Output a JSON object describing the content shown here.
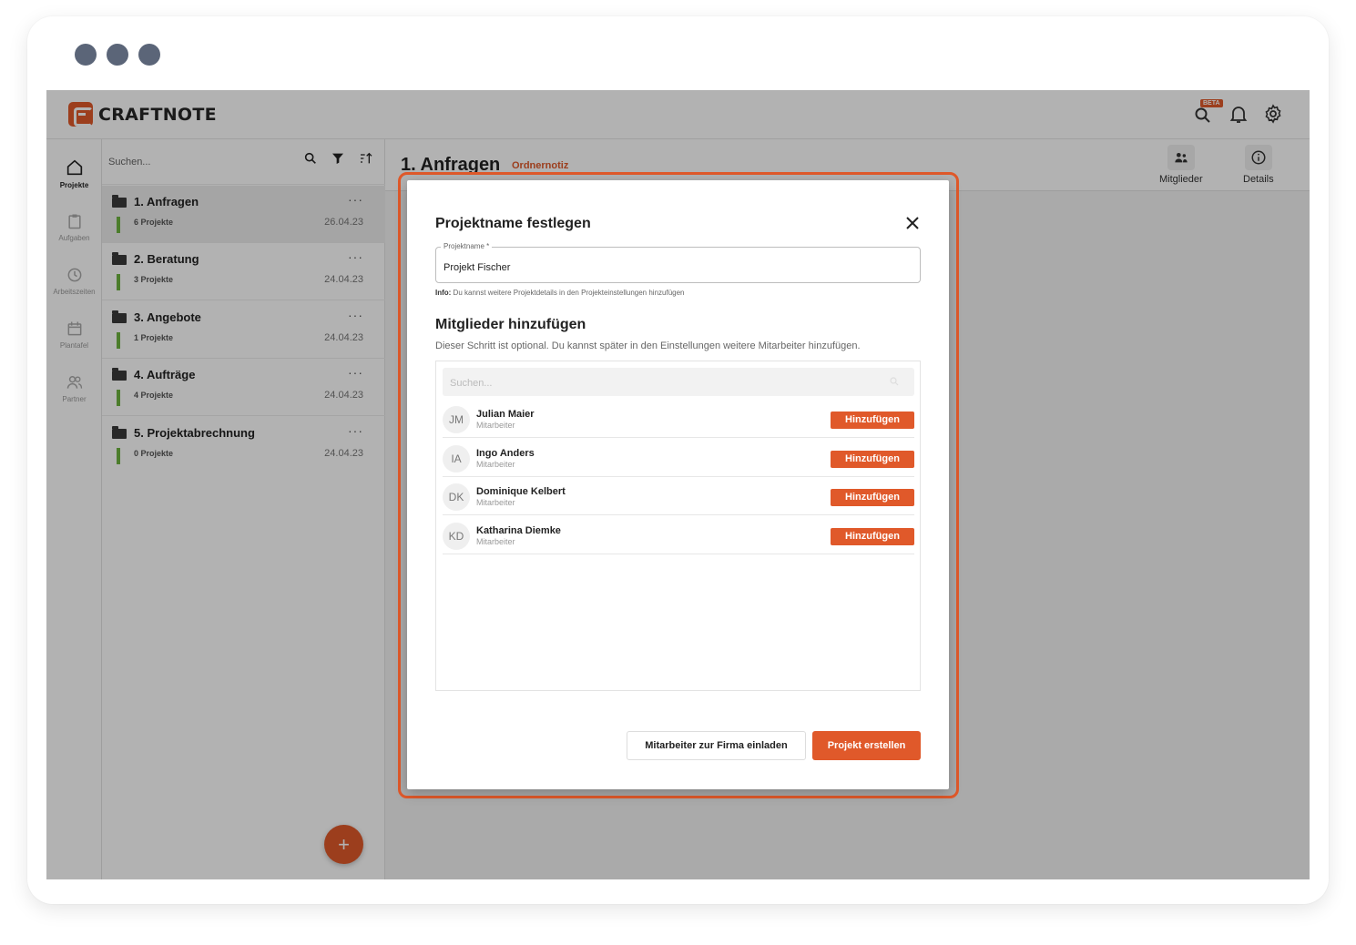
{
  "app": {
    "brand": "CRAFTNOTE",
    "beta_badge": "BETA",
    "accent_color": "#e0592a"
  },
  "nav": [
    {
      "label": "Projekte",
      "icon": "home-icon",
      "active": true
    },
    {
      "label": "Aufgaben",
      "icon": "clipboard-icon",
      "active": false
    },
    {
      "label": "Arbeitszeiten",
      "icon": "clock-icon",
      "active": false
    },
    {
      "label": "Plantafel",
      "icon": "calendar-icon",
      "active": false
    },
    {
      "label": "Partner",
      "icon": "users-icon",
      "active": false
    }
  ],
  "list": {
    "search_placeholder": "Suchen...",
    "folders": [
      {
        "name": "1. Anfragen",
        "count": "6 Projekte",
        "date": "26.04.23",
        "selected": true
      },
      {
        "name": "2. Beratung",
        "count": "3 Projekte",
        "date": "24.04.23",
        "selected": false
      },
      {
        "name": "3. Angebote",
        "count": "1 Projekte",
        "date": "24.04.23",
        "selected": false
      },
      {
        "name": "4. Aufträge",
        "count": "4 Projekte",
        "date": "24.04.23",
        "selected": false
      },
      {
        "name": "5. Projektabrechnung",
        "count": "0 Projekte",
        "date": "24.04.23",
        "selected": false
      }
    ],
    "more": "···",
    "fab_label": "+"
  },
  "main": {
    "title": "1. Anfragen",
    "note": "Ordnernotiz",
    "members_label": "Mitglieder",
    "details_label": "Details"
  },
  "modal": {
    "title": "Projektname festlegen",
    "field_label": "Projektname *",
    "field_value": "Projekt Fischer",
    "info_prefix": "Info:",
    "info_text": " Du kannst weitere Projektdetails in den Projekteinstellungen hinzufügen",
    "members_title": "Mitglieder hinzufügen",
    "members_desc": "Dieser Schritt ist optional. Du kannst später in den Einstellungen weitere Mitarbeiter hinzufügen.",
    "search_placeholder": "Suchen...",
    "members": [
      {
        "initials": "JM",
        "name": "Julian Maier",
        "role": "Mitarbeiter",
        "action": "Hinzufügen"
      },
      {
        "initials": "IA",
        "name": "Ingo Anders",
        "role": "Mitarbeiter",
        "action": "Hinzufügen"
      },
      {
        "initials": "DK",
        "name": "Dominique Kelbert",
        "role": "Mitarbeiter",
        "action": "Hinzufügen"
      },
      {
        "initials": "KD",
        "name": "Katharina Diemke",
        "role": "Mitarbeiter",
        "action": "Hinzufügen"
      }
    ],
    "invite_button": "Mitarbeiter zur Firma einladen",
    "create_button": "Projekt erstellen"
  }
}
